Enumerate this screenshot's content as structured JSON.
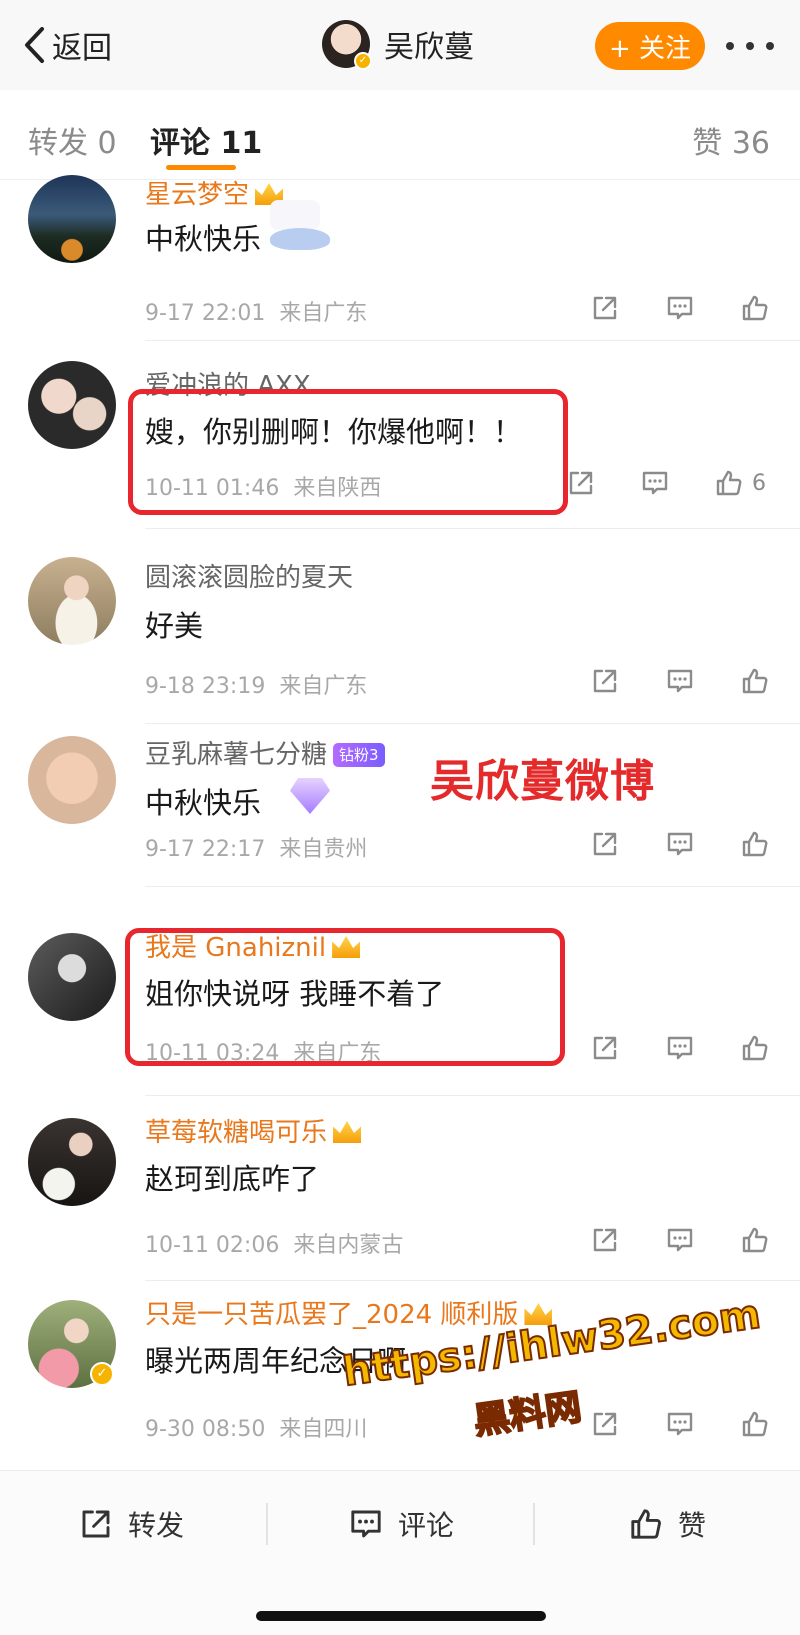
{
  "nav": {
    "back_label": "返回",
    "username": "吴欣蔓",
    "follow_label": "+ 关注"
  },
  "tabs": {
    "repost": "转发 0",
    "comment": "评论 11",
    "like": "赞 36"
  },
  "comments": [
    {
      "name": "星云梦空",
      "text": "中秋快乐",
      "time": "9-17 22:01",
      "from": "来自广东",
      "likes": ""
    },
    {
      "name": "爱冲浪的 AXX",
      "text": "嫂，你别删啊！你爆他啊！！",
      "time": "10-11 01:46",
      "from": "来自陕西",
      "likes": "6"
    },
    {
      "name": "圆滚滚圆脸的夏天",
      "text": "好美",
      "time": "9-18 23:19",
      "from": "来自广东",
      "likes": ""
    },
    {
      "name": "豆乳麻薯七分糖",
      "badge": "钻粉3",
      "text": "中秋快乐",
      "time": "9-17 22:17",
      "from": "来自贵州",
      "likes": ""
    },
    {
      "name": "我是 Gnahiznil",
      "text": "姐你快说呀 我睡不着了",
      "time": "10-11 03:24",
      "from": "来自广东",
      "likes": ""
    },
    {
      "name": "草莓软糖喝可乐",
      "text": "赵珂到底咋了",
      "time": "10-11 02:06",
      "from": "来自内蒙古",
      "likes": ""
    },
    {
      "name": "只是一只苦瓜罢了_2024 顺利版",
      "text": "曝光两周年纪念日啊",
      "time": "9-30 08:50",
      "from": "来自四川",
      "likes": ""
    }
  ],
  "watermarks": {
    "red": "吴欣蔓微博",
    "url": "https://ihlw32.com",
    "site": "黑料网"
  },
  "bottom": {
    "repost": "转发",
    "comment": "评论",
    "like": "赞"
  },
  "colors": {
    "accent": "#ff8a00",
    "highlight": "#e8262d",
    "vip_name": "#e9781c"
  }
}
